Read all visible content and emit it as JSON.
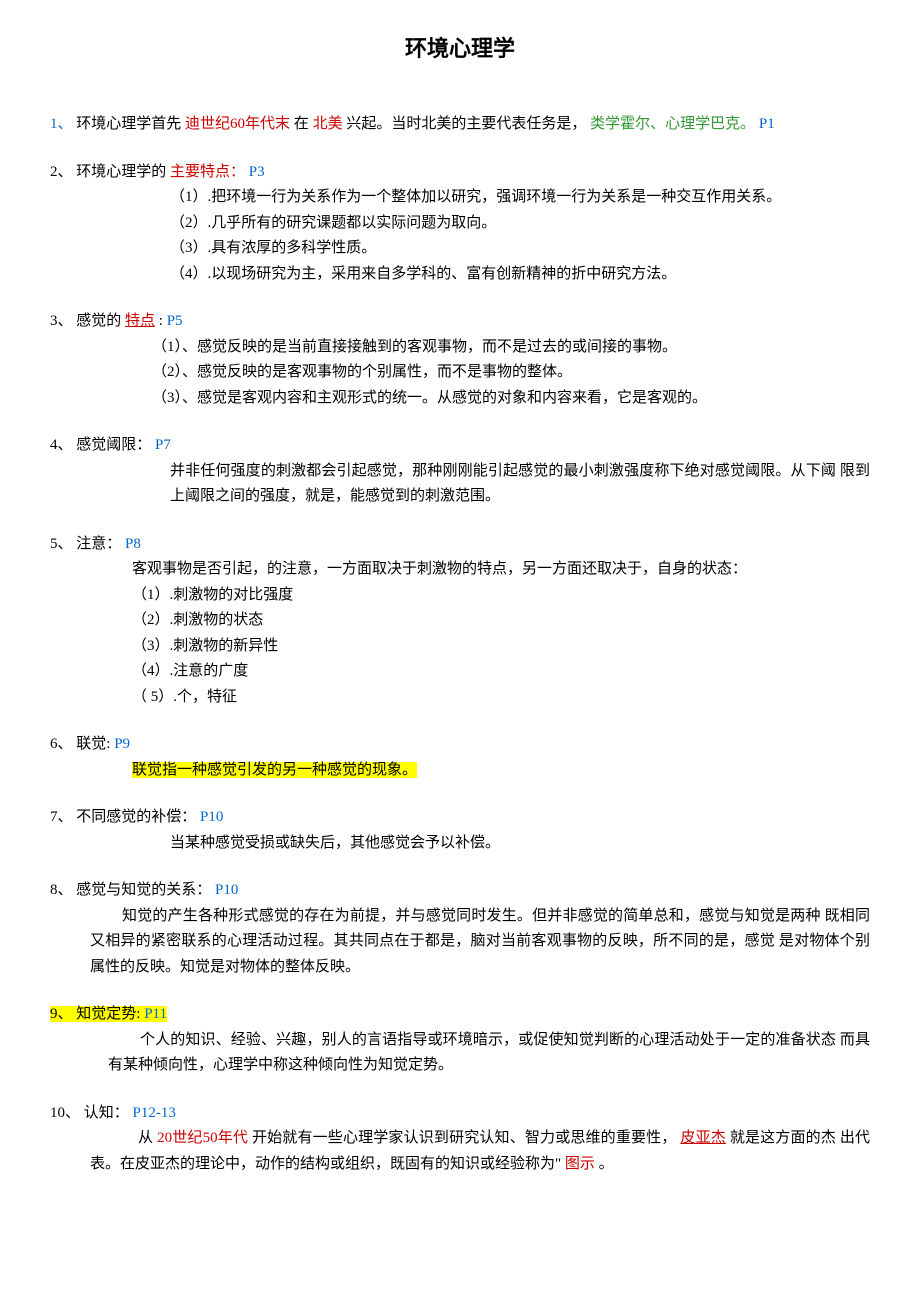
{
  "title": "环境心理学",
  "s1": {
    "num": "1、",
    "t1": "环境心理学首先",
    "red1": "迪世纪60年代末",
    "t2": "在",
    "red2": "北美",
    "t3": "兴起。当时北美的主要代表任务是，",
    "green1": "类学霍尔、心理学巴克。",
    "p": "P1"
  },
  "s2": {
    "num": "2、",
    "t1": "环境心理学的",
    "red": "主要特点：",
    "p": "P3",
    "items": [
      "（1）.把环境一行为关系作为一个整体加以研究，强调环境一行为关系是一种交互作用关系。",
      "（2）.几乎所有的研究课题都以实际问题为取向。",
      "（3）.具有浓厚的多科学性质。",
      "（4）.以现场研究为主，采用来自多学科的、富有创新精神的折中研究方法。"
    ]
  },
  "s3": {
    "num": "3、",
    "t1": "感觉的",
    "red": "特点",
    "t2": ":",
    "p": "P5",
    "items": [
      "（1）、感觉反映的是当前直接接触到的客观事物，而不是过去的或间接的事物。",
      "（2）、感觉反映的是客观事物的个别属性，而不是事物的整体。",
      "（3）、感觉是客观内容和主观形式的统一。从感觉的对象和内容来看，它是客观的。"
    ]
  },
  "s4": {
    "num": "4、",
    "t1": "感觉阈限：  ",
    "p": "P7",
    "body": "并非任何强度的刺激都会引起感觉，那种刚刚能引起感觉的最小刺激强度称下绝对感觉阈限。从下阈  限到上阈限之间的强度，就是，能感觉到的刺激范围。"
  },
  "s5": {
    "num": "5、",
    "t1": "注意：  ",
    "p": "P8",
    "lead": "客观事物是否引起，的注意，一方面取决于刺激物的特点，另一方面还取决于，自身的状态：",
    "items": [
      "（1）.刺激物的对比强度",
      "（2）.刺激物的状态",
      "（3）.刺激物的新异性",
      "（4）.注意的广度",
      "（ 5）.个，特征"
    ]
  },
  "s6": {
    "num": "6、",
    "t1": "联觉:",
    "p": "P9",
    "hl": "联觉指一种感觉引发的另一种感觉的现象。"
  },
  "s7": {
    "num": "7、",
    "t1": "不同感觉的补偿：  ",
    "p": "P10",
    "body": "当某种感觉受损或缺失后，其他感觉会予以补偿。"
  },
  "s8": {
    "num": "8、",
    "t1": "感觉与知觉的关系：  ",
    "p": "P10",
    "body": "知觉的产生各种形式感觉的存在为前提，并与感觉同时发生。但并非感觉的简单总和，感觉与知觉是两种  既相同又相异的紧密联系的心理活动过程。其共同点在于都是，脑对当前客观事物的反映，所不同的是，感觉  是对物体个别属性的反映。知觉是对物体的整体反映。"
  },
  "s9": {
    "num": "9、",
    "t1": "知觉定势:",
    "p": "P11",
    "body": "个人的知识、经验、兴趣，别人的言语指导或环境暗示，或促使知觉判断的心理活动处于一定的准备状态  而具有某种倾向性，心理学中称这种倾向性为知觉定势。"
  },
  "s10": {
    "num": "10、",
    "t1": "认知：  ",
    "p": "P12-13",
    "b1": "从",
    "red1": "20世纪50年代",
    "b2": "开始就有一些心理学家认识到研究认知、智力或思维的重要性，",
    "red2": "皮亚杰",
    "b3": "就是这方面的杰  出代表。在皮亚杰的理论中，动作的结构或组织，既固有的知识或经验称为\"",
    "red3": "图示",
    "b4": "。"
  }
}
